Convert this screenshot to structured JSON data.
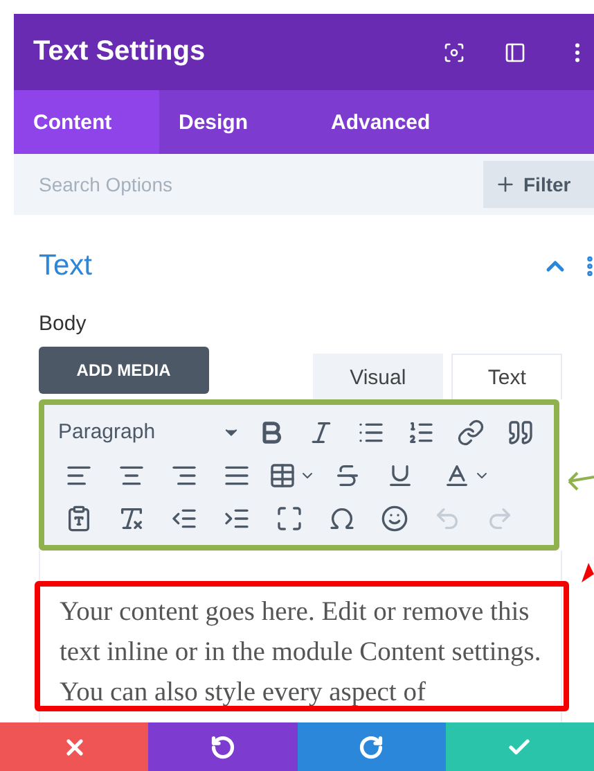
{
  "panel": {
    "title": "Text Settings"
  },
  "tabs": [
    {
      "label": "Content",
      "selected": true
    },
    {
      "label": "Design",
      "selected": false
    },
    {
      "label": "Advanced",
      "selected": false
    }
  ],
  "search": {
    "placeholder": "Search Options",
    "filter_label": "Filter"
  },
  "section": {
    "title": "Text",
    "expanded": true
  },
  "field": {
    "label": "Body",
    "add_media": "ADD MEDIA"
  },
  "editor_tabs": [
    {
      "label": "Visual",
      "selected": true
    },
    {
      "label": "Text",
      "selected": false
    }
  ],
  "toolbar": [
    [
      {
        "kind": "format",
        "label": "Paragraph",
        "disabled": false
      },
      {
        "kind": "bold",
        "disabled": false
      },
      {
        "kind": "italic",
        "disabled": false
      },
      {
        "kind": "bullets",
        "disabled": false
      },
      {
        "kind": "numbers",
        "disabled": false
      },
      {
        "kind": "link",
        "disabled": false
      },
      {
        "kind": "quote",
        "disabled": false
      }
    ],
    [
      {
        "kind": "align-left",
        "disabled": false
      },
      {
        "kind": "align-center",
        "disabled": false
      },
      {
        "kind": "align-right",
        "disabled": false
      },
      {
        "kind": "justify",
        "disabled": false
      },
      {
        "kind": "table",
        "disabled": false
      },
      {
        "kind": "strike",
        "disabled": false
      },
      {
        "kind": "underline",
        "disabled": false
      },
      {
        "kind": "text-color",
        "disabled": false
      }
    ],
    [
      {
        "kind": "paste-text",
        "disabled": false
      },
      {
        "kind": "clear-format",
        "disabled": false
      },
      {
        "kind": "outdent",
        "disabled": false
      },
      {
        "kind": "indent",
        "disabled": false
      },
      {
        "kind": "fullscreen",
        "disabled": false
      },
      {
        "kind": "symbol",
        "disabled": false
      },
      {
        "kind": "emoji",
        "disabled": false
      },
      {
        "kind": "undo",
        "disabled": true
      },
      {
        "kind": "redo",
        "disabled": true
      }
    ]
  ],
  "content": "Your content goes here. Edit or remove this text inline or in the module Content settings. You can also style every aspect of",
  "actions": [
    {
      "kind": "discard",
      "color": "#ef5555"
    },
    {
      "kind": "undo",
      "color": "#7e3bd0"
    },
    {
      "kind": "redo",
      "color": "#2b87da"
    },
    {
      "kind": "save",
      "color": "#29c4a9"
    }
  ]
}
